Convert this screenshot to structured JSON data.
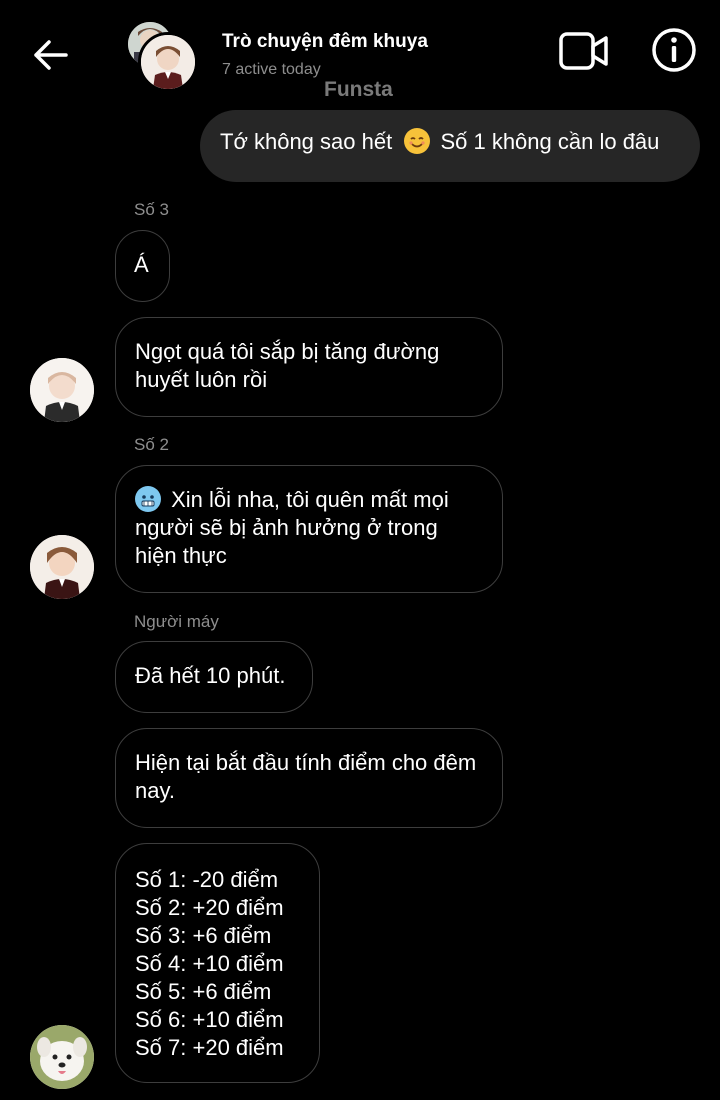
{
  "header": {
    "title": "Trò chuyện đêm khuya",
    "subtitle": "7 active today",
    "watermark": "Funsta"
  },
  "messages": {
    "m1": {
      "text_a": "Tớ không sao hết",
      "text_b": "Số 1 không cần lo đâu"
    },
    "s3_label": "Số 3",
    "m2": {
      "text": "Á"
    },
    "m3": {
      "text": "Ngọt quá tôi sắp bị tăng đường huyết luôn rồi"
    },
    "s2_label": "Số 2",
    "m4": {
      "text": "Xin lỗi nha, tôi quên mất mọi người sẽ bị ảnh hưởng ở trong hiện thực"
    },
    "robot_label": "Người máy",
    "m5": {
      "text": "Đã hết 10 phút."
    },
    "m6": {
      "text": "Hiện tại bắt đầu tính điểm cho đêm nay."
    },
    "scores": [
      "Số 1: -20 điểm",
      "Số 2: +20 điểm",
      "Số 3: +6 điểm",
      "Số 4: +10 điểm",
      "Số 5: +6 điểm",
      "Số 6: +10 điểm",
      "Số 7: +20 điểm"
    ]
  },
  "colors": {
    "background": "#000000",
    "outgoing_bubble": "#262626",
    "incoming_border": "#3d3d3d",
    "muted_text": "#8e8e8e"
  },
  "icons": [
    "back-arrow-icon",
    "video-call-icon",
    "info-icon",
    "smiling-emoji-icon",
    "cold-face-emoji-icon"
  ]
}
